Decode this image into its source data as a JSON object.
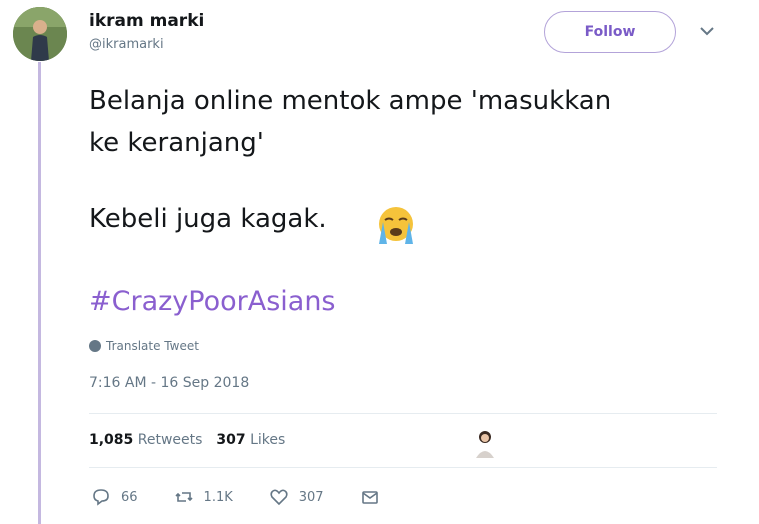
{
  "user": {
    "name": "ikram marki",
    "handle": "@ikramarki"
  },
  "follow_label": "Follow",
  "tweet": {
    "line1": "Belanja online mentok ampe 'masukkan",
    "line2": "ke keranjang'",
    "line3": "Kebeli juga kagak.",
    "hashtag": "#CrazyPoorAsians"
  },
  "translate_label": "Translate Tweet",
  "timestamp": "7:16 AM - 16 Sep 2018",
  "stats": {
    "retweets_count": "1,085",
    "retweets_label": "Retweets",
    "likes_count": "307",
    "likes_label": "Likes"
  },
  "actions": {
    "replies": "66",
    "retweets": "1.1K",
    "likes": "307"
  },
  "colors": {
    "accent": "#8a5fcf",
    "thread_line": "#c4b8e0"
  }
}
